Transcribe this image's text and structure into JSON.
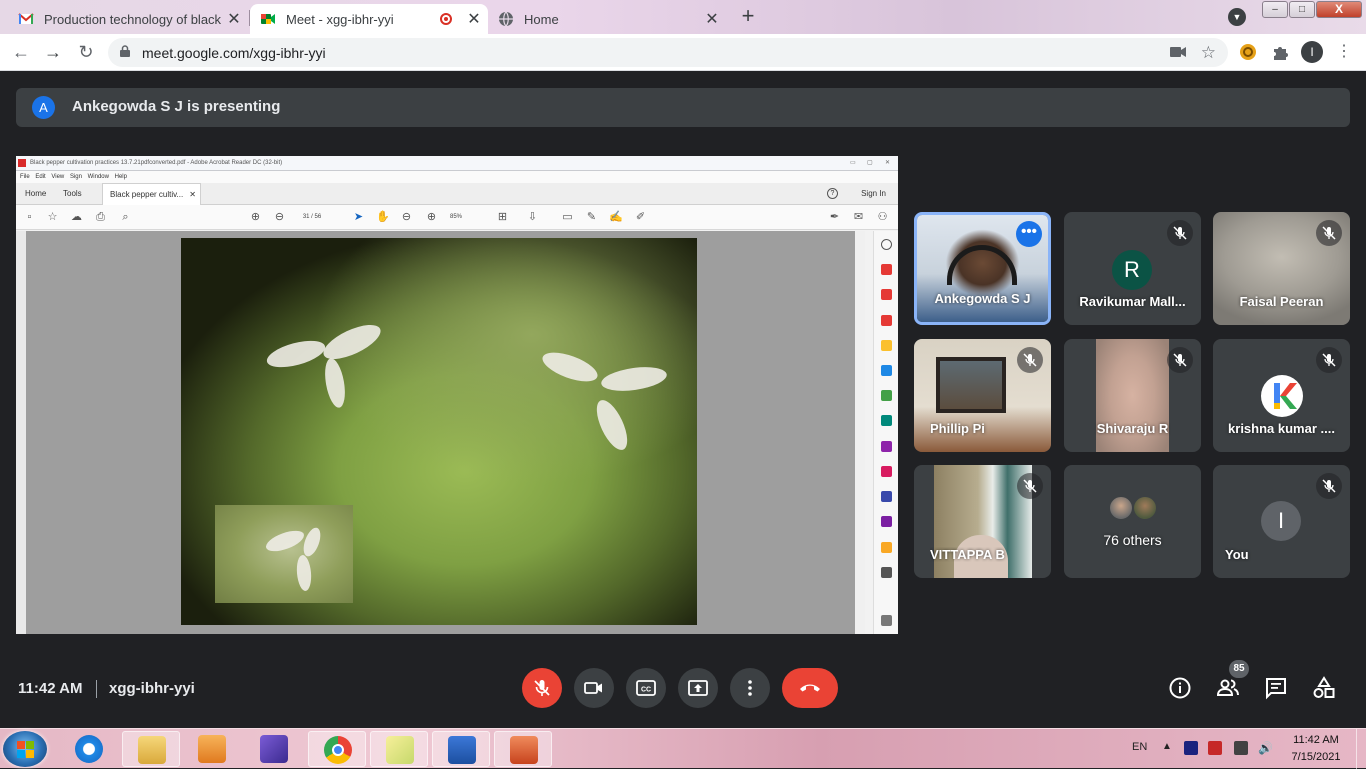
{
  "browser": {
    "tabs": [
      {
        "title": "Production technology of black pepper",
        "favicon": "gmail-icon"
      },
      {
        "title": "Meet - xgg-ibhr-yyi",
        "favicon": "meet-icon",
        "active": true,
        "recording": true
      },
      {
        "title": "Home",
        "favicon": "globe-icon"
      }
    ],
    "url": "meet.google.com/xgg-ibhr-yyi",
    "profile_initial": "I",
    "window_controls": {
      "minimize": "–",
      "maximize": "□",
      "close": "X"
    }
  },
  "meet": {
    "banner": {
      "avatar_initial": "A",
      "text": "Ankegowda S J is presenting"
    },
    "presentation": {
      "window_title": "Black pepper cultivation practices 13.7.21pdfconverted.pdf - Adobe Acrobat Reader DC (32-bit)",
      "menu": [
        "File",
        "Edit",
        "View",
        "Sign",
        "Window",
        "Help"
      ],
      "tabs": {
        "home": "Home",
        "tools": "Tools",
        "document": "Black pepper cultiv...",
        "sign_in": "Sign In"
      },
      "page_indicator": "31 / 56",
      "zoom": "85%"
    },
    "participants": [
      {
        "name": "Ankegowda S J",
        "muted": false,
        "presenter": true
      },
      {
        "name": "Ravikumar Mall...",
        "initial": "R",
        "muted": true,
        "avatar_color": "#0b5345"
      },
      {
        "name": "Faisal Peeran",
        "muted": true
      },
      {
        "name": "Phillip Pi",
        "muted": true
      },
      {
        "name": "Shivaraju R",
        "muted": true
      },
      {
        "name": "krishna kumar ....",
        "muted": true,
        "avatar": "k-logo"
      },
      {
        "name": "VITTAPPA B",
        "muted": true
      },
      {
        "name": "76 others",
        "muted": false
      },
      {
        "name": "You",
        "initial": "I",
        "muted": true,
        "avatar_color": "#5f6368"
      }
    ],
    "bottom_bar": {
      "time": "11:42 AM",
      "meeting_code": "xgg-ibhr-yyi",
      "people_count": "85"
    }
  },
  "taskbar": {
    "language": "EN",
    "time": "11:42 AM",
    "date": "7/15/2021"
  },
  "colors": {
    "meet_bg": "#202124",
    "tile_bg": "#3c4043",
    "danger": "#ea4335",
    "presenter_border": "#8ab4f8"
  }
}
